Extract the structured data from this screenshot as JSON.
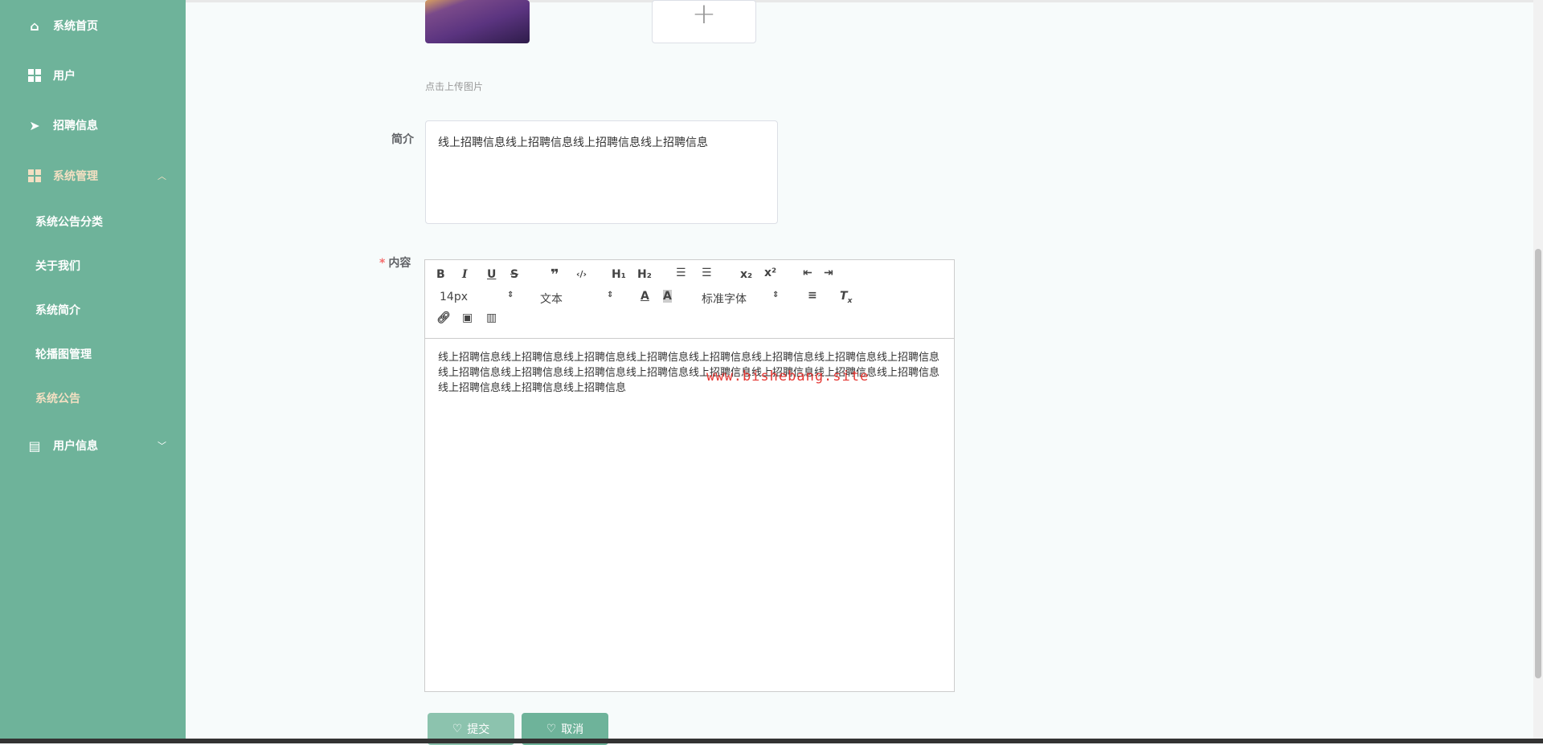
{
  "sidebar": {
    "items": [
      {
        "label": "系统首页",
        "icon": "home-icon"
      },
      {
        "label": "用户",
        "icon": "grid-icon"
      },
      {
        "label": "招聘信息",
        "icon": "send-icon"
      },
      {
        "label": "系统管理",
        "icon": "grid-icon",
        "expanded": true
      },
      {
        "label": "用户信息",
        "icon": "card-icon",
        "expanded": false
      }
    ],
    "sub_items": [
      "系统公告分类",
      "关于我们",
      "系统简介",
      "轮播图管理",
      "系统公告"
    ]
  },
  "form": {
    "upload_hint": "点击上传图片",
    "intro_label": "简介",
    "intro_value": "线上招聘信息线上招聘信息线上招聘信息线上招聘信息",
    "content_label": "内容",
    "editor": {
      "font_size": "14px",
      "header": "文本",
      "font_family": "标准字体",
      "content": "线上招聘信息线上招聘信息线上招聘信息线上招聘信息线上招聘信息线上招聘信息线上招聘信息线上招聘信息线上招聘信息线上招聘信息线上招聘信息线上招聘信息线上招聘信息线上招聘信息线上招聘信息线上招聘信息线上招聘信息线上招聘信息线上招聘信息"
    },
    "watermark": "www.bishebang.site",
    "submit_label": "提交",
    "cancel_label": "取消"
  },
  "colors": {
    "sidebar": "#6eb39a",
    "active": "#f3dfc2",
    "button": "#6eb39a"
  }
}
